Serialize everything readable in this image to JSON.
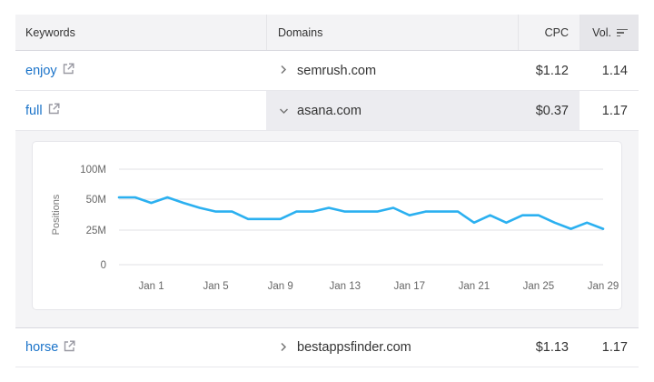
{
  "table": {
    "headers": {
      "keywords": "Keywords",
      "domains": "Domains",
      "cpc": "CPC",
      "vol": "Vol."
    },
    "rows": [
      {
        "keyword": "enjoy",
        "domain": "semrush.com",
        "cpc": "$1.12",
        "vol": "1.14",
        "expanded": false
      },
      {
        "keyword": "full",
        "domain": "asana.com",
        "cpc": "$0.37",
        "vol": "1.17",
        "expanded": true
      },
      {
        "keyword": "horse",
        "domain": "bestappsfinder.com",
        "cpc": "$1.13",
        "vol": "1.17",
        "expanded": false
      }
    ],
    "icons": {
      "external": "external-link-icon",
      "sort": "sort-descending-icon",
      "collapsed": "chevron-right-icon",
      "expanded": "chevron-down-icon"
    }
  },
  "colors": {
    "link": "#1a73c9",
    "line": "#2bb0f0",
    "grid": "#e2e2e6"
  },
  "chart_data": {
    "type": "line",
    "ylabel": "Positions",
    "yticks": [
      "100M",
      "50M",
      "25M",
      "0"
    ],
    "xticks": [
      "Jan 1",
      "Jan 5",
      "Jan 9",
      "Jan 13",
      "Jan 17",
      "Jan 21",
      "Jan 25",
      "Jan 29"
    ],
    "grid": true,
    "x": [
      "Dec 30",
      "Dec 31",
      "Jan 1",
      "Jan 2",
      "Jan 3",
      "Jan 4",
      "Jan 5",
      "Jan 6",
      "Jan 7",
      "Jan 8",
      "Jan 9",
      "Jan 10",
      "Jan 11",
      "Jan 12",
      "Jan 13",
      "Jan 14",
      "Jan 15",
      "Jan 16",
      "Jan 17",
      "Jan 18",
      "Jan 19",
      "Jan 20",
      "Jan 21",
      "Jan 22",
      "Jan 23",
      "Jan 24",
      "Jan 25",
      "Jan 26",
      "Jan 27",
      "Jan 28",
      "Jan 29",
      "Jan 30",
      "Jan 31"
    ],
    "series": [
      {
        "values": [
          53,
          53,
          47,
          53,
          47,
          43,
          40,
          40,
          34,
          34,
          34,
          40,
          40,
          43,
          40,
          40,
          40,
          43,
          37,
          40,
          40,
          40,
          31,
          37,
          31,
          37,
          37,
          31,
          26,
          31,
          26
        ]
      }
    ]
  }
}
